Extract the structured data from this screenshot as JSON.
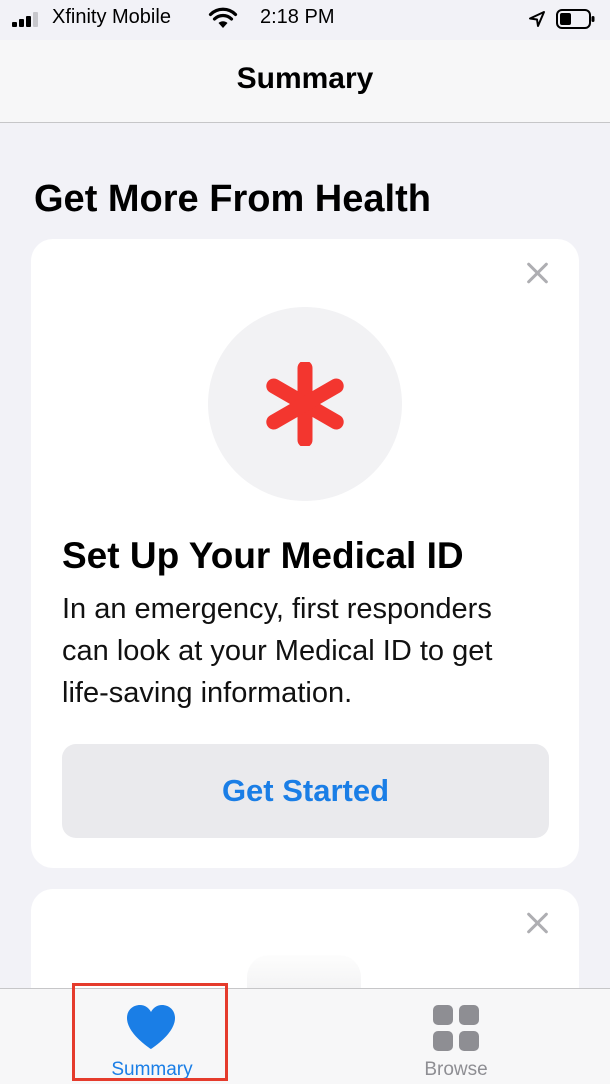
{
  "status_bar": {
    "carrier": "Xfinity Mobile",
    "time": "2:18 PM",
    "icons": [
      "signal-icon",
      "wifi-icon",
      "location-icon",
      "battery-icon"
    ]
  },
  "nav": {
    "title": "Summary"
  },
  "section": {
    "title": "Get More From Health"
  },
  "medical_id_card": {
    "icon": "asterisk-icon",
    "heading": "Set Up Your Medical ID",
    "body_lines": [
      "In an emergency, first responders",
      "can look at your Medical ID to get",
      "life-saving information."
    ],
    "button_label": "Get Started"
  },
  "tab_bar": {
    "tabs": [
      {
        "label": "Summary",
        "icon": "heart-icon",
        "selected": true
      },
      {
        "label": "Browse",
        "icon": "grid-icon",
        "selected": false
      }
    ]
  },
  "colors": {
    "accent": "#1a7ee6",
    "asterisk": "#f3362f",
    "background": "#f2f2f7",
    "highlight": "#e53b2c"
  }
}
